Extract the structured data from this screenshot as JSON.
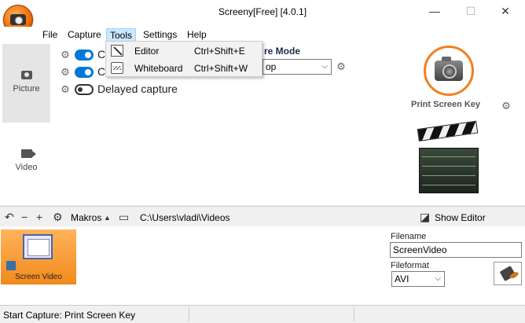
{
  "window": {
    "title": "Screeny[Free] [4.0.1]",
    "minimize": "—",
    "maximize": "☐",
    "close": "✕"
  },
  "menubar": {
    "items": [
      "File",
      "Capture",
      "Tools",
      "Settings",
      "Help"
    ],
    "active": "Tools"
  },
  "tools_menu": {
    "items": [
      {
        "label": "Editor",
        "shortcut": "Ctrl+Shift+E",
        "icon": "editor-icon"
      },
      {
        "label": "Whiteboard",
        "shortcut": "Ctrl+Shift+W",
        "icon": "whiteboard-icon"
      }
    ]
  },
  "nav": {
    "picture_label": "Picture",
    "video_label": "Video"
  },
  "options": {
    "opt1_label": "C",
    "opt2_label": "C",
    "delayed_label": "Delayed capture",
    "opt1_on": true,
    "opt2_on": true,
    "delayed_on": false
  },
  "capture_mode": {
    "label": "re Mode",
    "value": "op"
  },
  "print_screen": {
    "label": "Print Screen Key"
  },
  "toolbar": {
    "makros_label": "Makros",
    "path": "C:\\Users\\vladi\\Videos",
    "show_editor_label": "Show Editor"
  },
  "output": {
    "tile_label": "Screen Video",
    "filename_label": "Filename",
    "filename_value": "ScreenVideo",
    "fileformat_label": "Fileformat",
    "fileformat_value": "AVI"
  },
  "status": {
    "text": "Start Capture: Print Screen Key"
  },
  "colors": {
    "accent": "#0078d7",
    "brand_orange": "#f08020",
    "menu_highlight": "#cce8ff"
  }
}
